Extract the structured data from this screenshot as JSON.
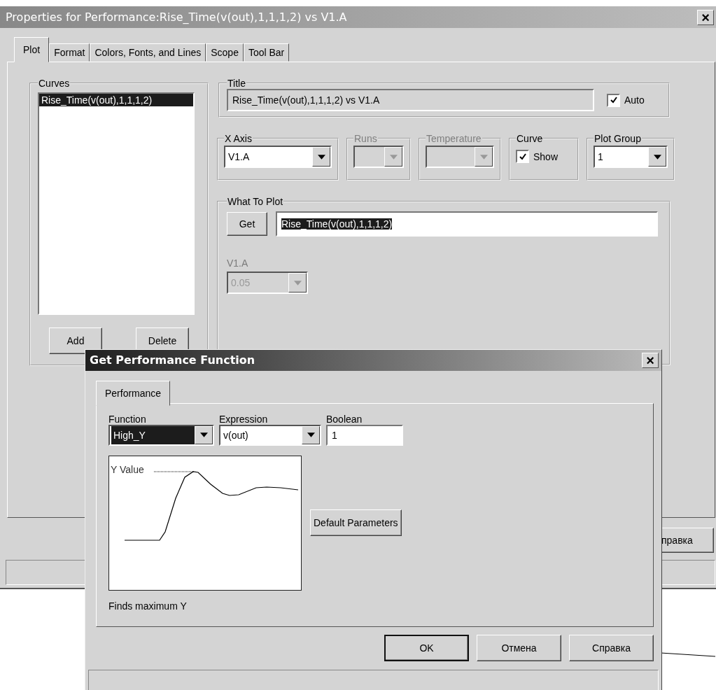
{
  "properties_window": {
    "title": "Properties for Performance:Rise_Time(v(out),1,1,1,2) vs V1.A",
    "close": "×",
    "tabs": [
      {
        "label": "Plot",
        "selected": true
      },
      {
        "label": "Format",
        "selected": false
      },
      {
        "label": "Colors, Fonts, and Lines",
        "selected": false
      },
      {
        "label": "Scope",
        "selected": false
      },
      {
        "label": "Tool Bar",
        "selected": false
      }
    ],
    "curves": {
      "label": "Curves",
      "items": [
        {
          "label": "Rise_Time(v(out),1,1,1,2)",
          "selected": true
        }
      ],
      "buttons": [
        "Add",
        "Delete"
      ]
    },
    "title_group": {
      "label": "Title",
      "value": "Rise_Time(v(out),1,1,1,2) vs V1.A",
      "auto": {
        "label": "Auto",
        "checked": true
      }
    },
    "options_row": [
      {
        "kind": "combo",
        "label": "X Axis",
        "value": "V1.A",
        "disabled": false
      },
      {
        "kind": "combo",
        "label": "Runs",
        "disabled": true
      },
      {
        "kind": "combo",
        "label": "Temperature",
        "disabled": true
      },
      {
        "kind": "checkbox",
        "label": "Curve",
        "option": "Show",
        "checked": true
      },
      {
        "kind": "combo",
        "label": "Plot Group",
        "value": "1",
        "disabled": false
      }
    ],
    "what_to_plot": {
      "label": "What To Plot",
      "button": "Get",
      "value": "Rise_Time(v(out),1,1,1,2)",
      "highlighted": true,
      "sweep": {
        "label": "V1.A",
        "value": "0.05",
        "disabled": true
      }
    },
    "footer_buttons": [
      "правка"
    ]
  },
  "performance_dialog": {
    "title": "Get Performance Function",
    "close": "×",
    "tabs": [
      {
        "label": "Performance",
        "selected": true
      }
    ],
    "fields": [
      {
        "kind": "combo",
        "label": "Function",
        "value": "High_Y",
        "highlighted": true
      },
      {
        "kind": "combo",
        "label": "Expression",
        "value": "v(out)",
        "highlighted": false
      },
      {
        "kind": "text",
        "label": "Boolean",
        "value": "1",
        "highlighted": false
      }
    ],
    "diagram": {
      "label": "Y Value"
    },
    "default_button": "Default Parameters",
    "description": "Finds maximum Y",
    "buttons": [
      {
        "label": "OK",
        "default": true
      },
      {
        "label": "Отмена",
        "default": false
      },
      {
        "label": "Справка",
        "default": false
      }
    ]
  }
}
